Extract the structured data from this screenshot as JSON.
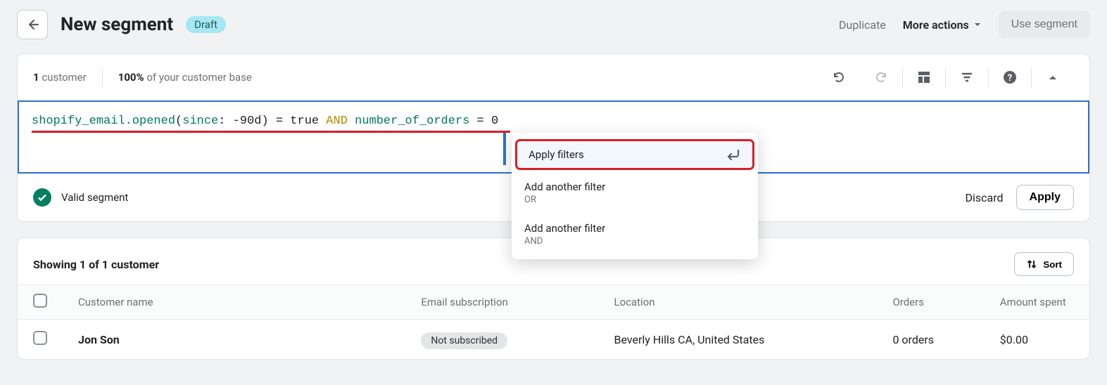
{
  "header": {
    "title": "New segment",
    "badge": "Draft",
    "duplicate": "Duplicate",
    "more_actions": "More actions",
    "use_segment": "Use segment"
  },
  "stats": {
    "count_value": "1",
    "count_label": "customer",
    "pct_value": "100%",
    "pct_label": "of your customer base"
  },
  "editor": {
    "tokens": {
      "t1": "shopify_email.opened",
      "t2": "(",
      "t3": "since",
      "t4": ":",
      "t5": " -90d",
      "t6": ")",
      "t7": " = ",
      "t8": "true",
      "t9": " AND ",
      "t10": "number_of_orders",
      "t11": " = ",
      "t12": "0"
    }
  },
  "popup": {
    "apply": "Apply filters",
    "add_or": "Add another filter",
    "or": "OR",
    "add_and": "Add another filter",
    "and": "AND"
  },
  "valid": {
    "label": "Valid segment",
    "discard": "Discard",
    "apply": "Apply"
  },
  "results": {
    "title": "Showing 1 of 1 customer",
    "sort": "Sort",
    "columns": {
      "name": "Customer name",
      "sub": "Email subscription",
      "loc": "Location",
      "orders": "Orders",
      "amount": "Amount spent"
    },
    "rows": [
      {
        "name": "Jon Son",
        "sub": "Not subscribed",
        "loc": "Beverly Hills CA, United States",
        "orders": "0 orders",
        "amount": "$0.00"
      }
    ]
  }
}
